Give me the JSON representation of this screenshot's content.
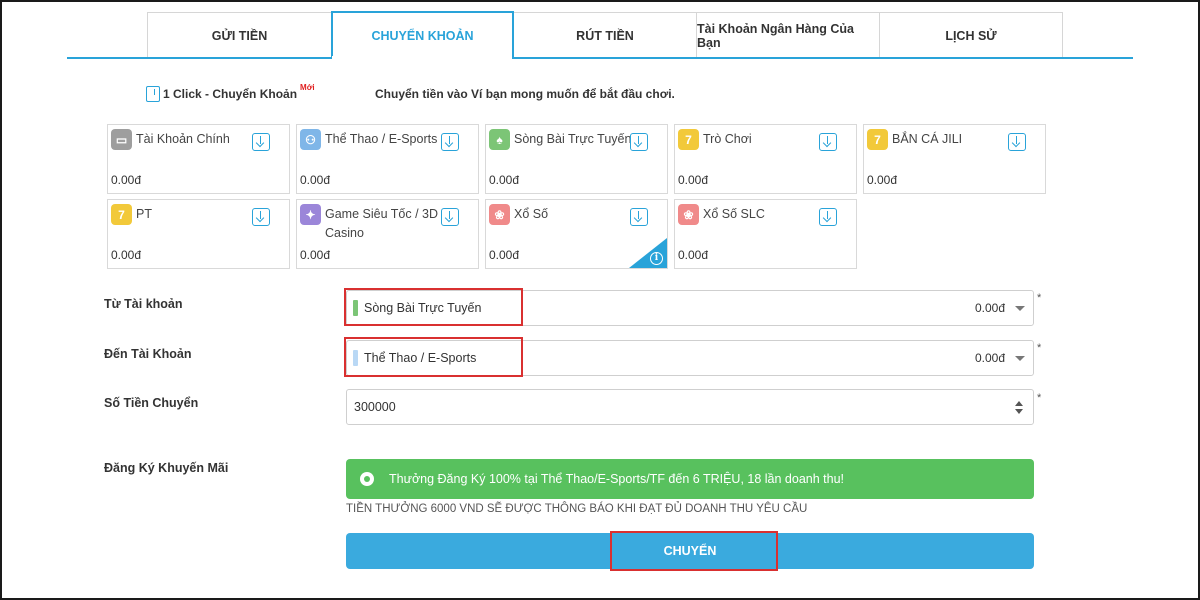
{
  "tabs": [
    {
      "label": "GỬI TIỀN",
      "active": false
    },
    {
      "label": "CHUYỂN KHOẢN",
      "active": true
    },
    {
      "label": "RÚT TIỀN",
      "active": false
    },
    {
      "label": "Tài Khoản Ngân Hàng Của Bạn",
      "active": false
    },
    {
      "label": "LỊCH SỬ",
      "active": false
    }
  ],
  "one_click": {
    "label": "1 Click - Chuyển Khoản",
    "badge": "Mới"
  },
  "instruction": "Chuyển tiền vào Ví bạn mong muốn để bắt đầu chơi.",
  "wallets": [
    {
      "name": "Tài Khoản Chính",
      "balance": "0.00đ",
      "icon": "wallet-icon",
      "color": "#9e9e9e"
    },
    {
      "name": "Thể Thao / E-Sports",
      "balance": "0.00đ",
      "icon": "sports-icon",
      "color": "#7fb6e8"
    },
    {
      "name": "Sòng Bài Trực Tuyến",
      "balance": "0.00đ",
      "icon": "cards-icon",
      "color": "#7cc576"
    },
    {
      "name": "Trò Chơi",
      "balance": "0.00đ",
      "icon": "slot-icon",
      "color": "#f2c93a"
    },
    {
      "name": "BẮN CÁ JILI",
      "balance": "0.00đ",
      "icon": "slot-icon",
      "color": "#f2c93a"
    },
    {
      "name": "PT",
      "balance": "0.00đ",
      "icon": "slot-icon",
      "color": "#f2c93a"
    },
    {
      "name": "Game Siêu Tốc / 3D Casino",
      "balance": "0.00đ",
      "icon": "game-icon",
      "color": "#9b86d9"
    },
    {
      "name": "Xổ Số",
      "balance": "0.00đ",
      "icon": "lottery-icon",
      "color": "#f08a8a"
    },
    {
      "name": "Xổ Số SLC",
      "balance": "0.00đ",
      "icon": "lottery-icon",
      "color": "#f08a8a"
    }
  ],
  "form": {
    "from": {
      "label": "Từ Tài khoản",
      "value": "Sòng Bài Trực Tuyến",
      "balance": "0.00đ",
      "color": "#7cc576"
    },
    "to": {
      "label": "Đến Tài Khoản",
      "value": "Thể Thao / E-Sports",
      "balance": "0.00đ",
      "color": "#b9d8f5"
    },
    "amount": {
      "label": "Số Tiền Chuyển",
      "value": "300000"
    },
    "required_mark": "*",
    "promo": {
      "label": "Đăng Ký Khuyến Mãi",
      "option": "Thưởng Đăng Ký 100% tại Thể Thao/E-Sports/TF đến 6 TRIỆU, 18 lần doanh thu!",
      "note": "TIỀN THƯỞNG 6000 VND SẼ ĐƯỢC THÔNG BÁO KHI ĐẠT ĐỦ DOANH THU YÊU CẦU"
    },
    "submit_label": "CHUYỂN"
  },
  "colors": {
    "accent": "#29a3d9",
    "button": "#3aaade",
    "promo": "#58c15e",
    "highlight": "#d93030"
  }
}
